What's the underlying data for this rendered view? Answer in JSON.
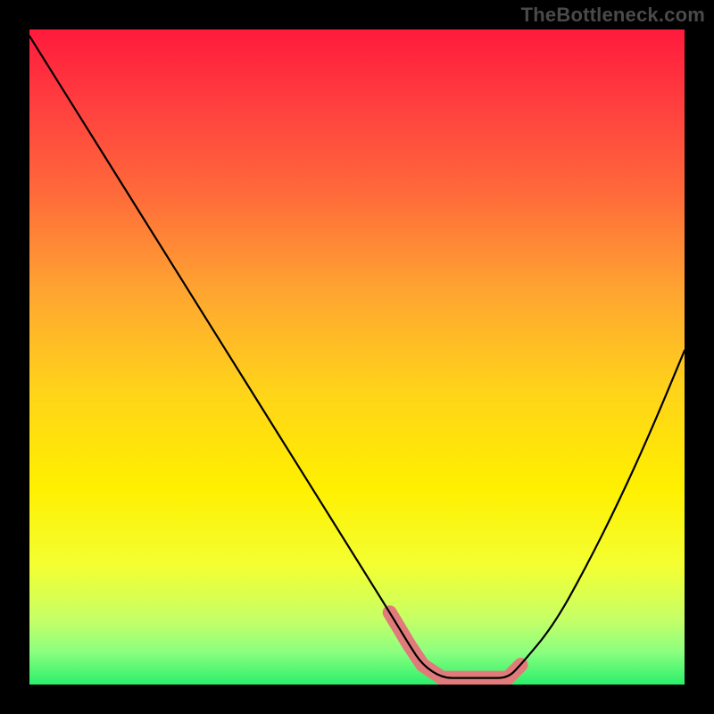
{
  "watermark": "TheBottleneck.com",
  "chart_data": {
    "type": "line",
    "title": "",
    "xlabel": "",
    "ylabel": "",
    "xlim": [
      0,
      100
    ],
    "ylim": [
      0,
      100
    ],
    "curve": {
      "x": [
        0,
        5,
        10,
        15,
        20,
        25,
        30,
        35,
        40,
        45,
        50,
        55,
        58,
        60,
        63,
        66,
        70,
        73,
        75,
        80,
        85,
        90,
        95,
        100
      ],
      "y": [
        99,
        91,
        83,
        75,
        67,
        59,
        51,
        43,
        35,
        27,
        19,
        11,
        6,
        3,
        1,
        1,
        1,
        1,
        3,
        9,
        18,
        28,
        39,
        51
      ]
    },
    "highlight_band": {
      "x": [
        55,
        58,
        60,
        63,
        66,
        70,
        73,
        75
      ],
      "y": [
        11,
        6,
        3,
        1,
        1,
        1,
        1,
        3
      ]
    },
    "gradient_stops": [
      {
        "offset": 0.0,
        "color": "#ff1a3c"
      },
      {
        "offset": 0.1,
        "color": "#ff3a3f"
      },
      {
        "offset": 0.25,
        "color": "#ff6a3a"
      },
      {
        "offset": 0.4,
        "color": "#ffa531"
      },
      {
        "offset": 0.55,
        "color": "#ffd31a"
      },
      {
        "offset": 0.7,
        "color": "#fff000"
      },
      {
        "offset": 0.82,
        "color": "#f3ff33"
      },
      {
        "offset": 0.9,
        "color": "#c6ff66"
      },
      {
        "offset": 0.95,
        "color": "#8cff80"
      },
      {
        "offset": 1.0,
        "color": "#2bef6b"
      }
    ]
  }
}
